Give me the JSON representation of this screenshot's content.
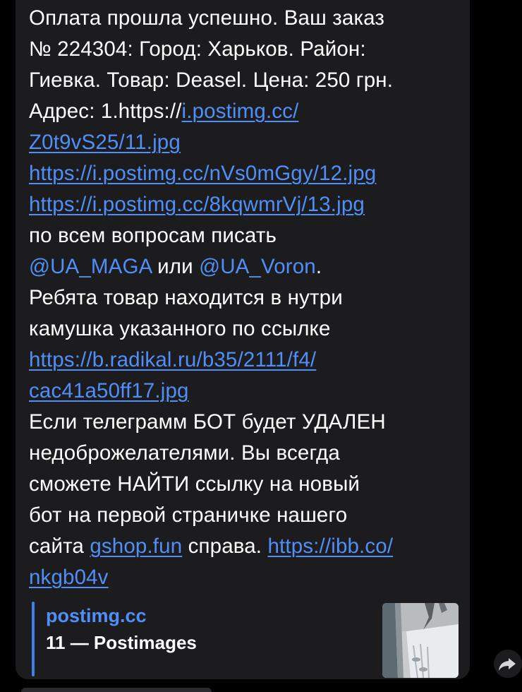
{
  "message": {
    "lines": [
      [
        {
          "t": "Оплата прошла успешно. Ваш заказ"
        }
      ],
      [
        {
          "t": "№ 224304: Город: Харьков. Район:"
        }
      ],
      [
        {
          "t": "Гиевка. Товар: Deasel. Цена: 250 грн."
        }
      ],
      [
        {
          "t": "Адрес: 1.https://"
        },
        {
          "t": "i.postimg.cc/",
          "k": "link"
        }
      ],
      [
        {
          "t": "Z0t9vS25/11.jpg",
          "k": "link"
        }
      ],
      [
        {
          "t": "https://i.postimg.cc/nVs0mGgy/12.jpg",
          "k": "link"
        }
      ],
      [
        {
          "t": "https://i.postimg.cc/8kqwmrVj/13.jpg",
          "k": "link"
        }
      ],
      [
        {
          "t": "по всем вопросам писать"
        }
      ],
      [
        {
          "t": "@UA_MAGA",
          "k": "mention"
        },
        {
          "t": " или "
        },
        {
          "t": "@UA_Voron",
          "k": "mention"
        },
        {
          "t": "."
        }
      ],
      [
        {
          "t": "Ребята товар находится в нутри"
        }
      ],
      [
        {
          "t": "камушка указанного по ссылке"
        }
      ],
      [
        {
          "t": "https://b.radikal.ru/b35/2111/f4/",
          "k": "link"
        }
      ],
      [
        {
          "t": "cac41a50ff17.jpg",
          "k": "link"
        }
      ],
      [
        {
          "t": "Если телеграмм БОТ будет УДАЛЕН"
        }
      ],
      [
        {
          "t": "недоброжелателями. Вы всегда"
        }
      ],
      [
        {
          "t": "сможете НАЙТИ ссылку на новый"
        }
      ],
      [
        {
          "t": "бот на первой страничке нашего"
        }
      ],
      [
        {
          "t": "сайта "
        },
        {
          "t": "gshop.fun",
          "k": "link"
        },
        {
          "t": " справа. "
        },
        {
          "t": "https://ibb.co/",
          "k": "link"
        }
      ],
      [
        {
          "t": "nkgb04v",
          "k": "link"
        }
      ]
    ]
  },
  "link_preview": {
    "site": "postimg.cc",
    "title": "11 — Postimages"
  },
  "icons": {
    "share": "share-arrow-icon"
  },
  "colors": {
    "background": "#000000",
    "bubble": "#1c1c1e",
    "text": "#ffffff",
    "link": "#4f8ff7",
    "preview_bar": "#3e7fea"
  }
}
